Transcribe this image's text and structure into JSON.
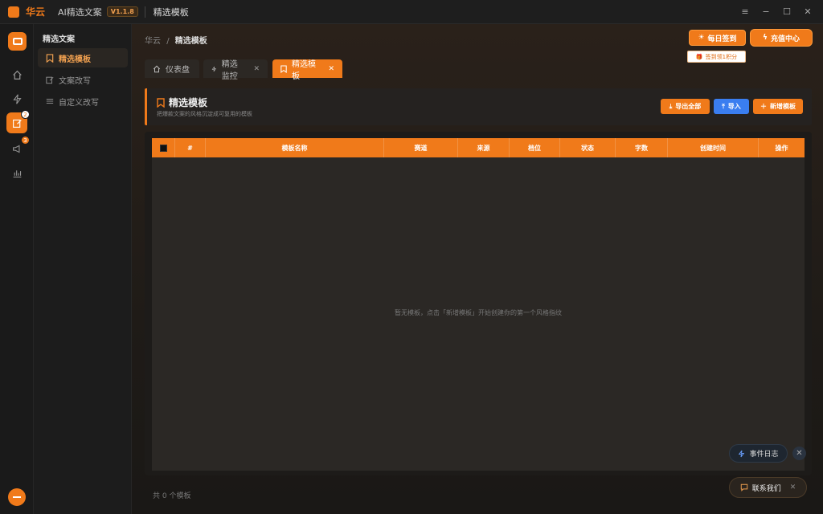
{
  "titlebar": {
    "brand": "华云",
    "app_name": "AI精选文案",
    "version": "V1.1.8",
    "page": "精选模板",
    "controls": [
      "≡",
      "−",
      "☐",
      "✕"
    ]
  },
  "rail": {
    "badges": {
      "edit": "2",
      "notice": "3"
    }
  },
  "subnav": {
    "title": "精选文案",
    "items": [
      {
        "label": "精选模板",
        "icon": "bookmark-icon"
      },
      {
        "label": "文案改写",
        "icon": "edit-icon"
      },
      {
        "label": "自定义改写",
        "icon": "sliders-icon"
      }
    ]
  },
  "breadcrumb": {
    "root": "华云",
    "sep": "/",
    "current": "精选模板"
  },
  "actions": {
    "checkin": "每日签到",
    "recharge": "充值中心",
    "tooltip": "签到领1积分"
  },
  "tabs": [
    {
      "label": "仪表盘",
      "icon": "home-icon",
      "closable": false
    },
    {
      "label": "精选监控",
      "icon": "bolt-icon",
      "closable": true
    },
    {
      "label": "精选模板",
      "icon": "bookmark-icon",
      "closable": true,
      "active": true
    }
  ],
  "header": {
    "title": "精选模板",
    "subtitle": "把爆款文案的风格沉淀成可复用的模板",
    "export_all": "导出全部",
    "import": "导入",
    "new_template": "新增模板"
  },
  "table": {
    "columns": [
      "",
      "#",
      "模板名称",
      "赛道",
      "来源",
      "档位",
      "状态",
      "字数",
      "创建时间",
      "操作"
    ],
    "empty_text": "暂无模板，点击「新增模板」开始创建你的第一个风格指纹"
  },
  "footer": {
    "count": "共 0 个模板"
  },
  "floating": {
    "event_log": "事件日志",
    "contact": "联系我们"
  },
  "colors": {
    "accent": "#f07a1a",
    "blue": "#3a7ef0"
  }
}
